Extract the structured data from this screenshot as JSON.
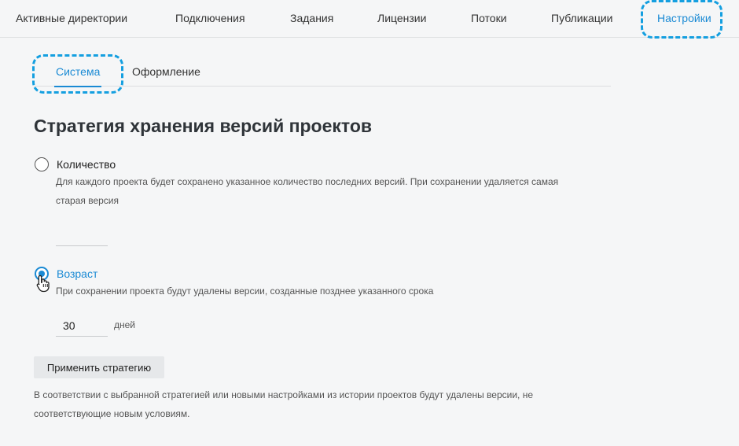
{
  "nav": {
    "items": [
      {
        "label": "Активные директории"
      },
      {
        "label": "Подключения"
      },
      {
        "label": "Задания"
      },
      {
        "label": "Лицензии"
      },
      {
        "label": "Потоки"
      },
      {
        "label": "Публикации"
      },
      {
        "label": "Настройки"
      }
    ],
    "active_index": 6
  },
  "subtabs": {
    "items": [
      {
        "label": "Система"
      },
      {
        "label": "Оформление"
      }
    ],
    "active_index": 0
  },
  "section": {
    "title": "Стратегия хранения версий проектов",
    "options": {
      "count": {
        "label": "Количество",
        "description": "Для каждого проекта будет сохранено указанное количество последних версий. При сохранении удаляется самая старая версия",
        "value": "",
        "selected": false
      },
      "age": {
        "label": "Возраст",
        "description": "При сохранении проекта будут удалены версии, созданные позднее указанного срока",
        "value": "30",
        "unit": "дней",
        "selected": true
      }
    },
    "apply_label": "Применить стратегию",
    "note": "В соответствии с выбранной стратегией или новыми настройками из истории проектов будут удалены версии, не соответствующие новым условиям."
  },
  "colors": {
    "accent": "#1a8ad4",
    "highlight": "#149fe0",
    "background": "#f5f6f7"
  }
}
